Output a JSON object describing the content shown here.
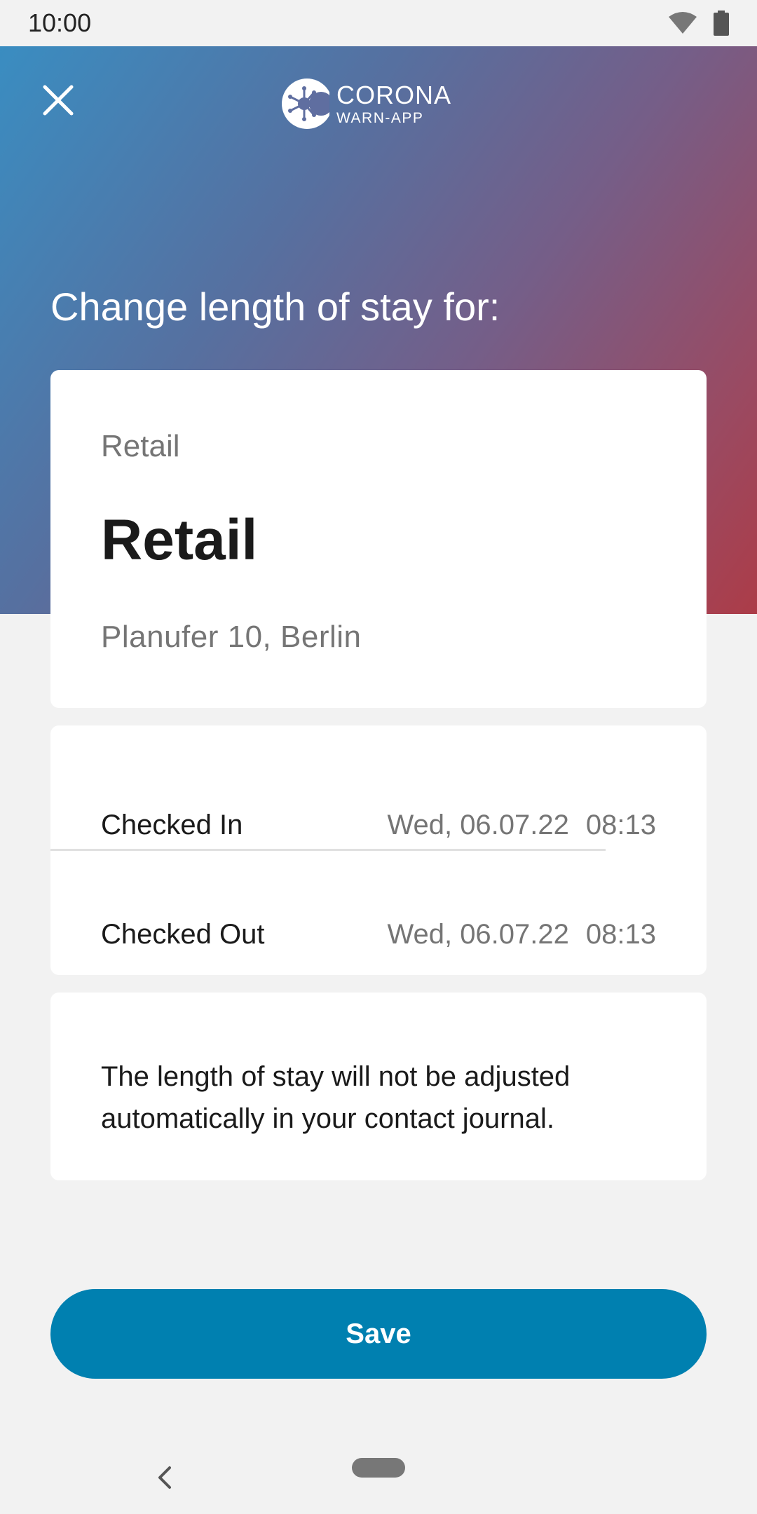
{
  "status_bar": {
    "time": "10:00"
  },
  "header": {
    "logo_line1": "CORONA",
    "logo_line2": "WARN-APP",
    "title": "Change length of stay for:"
  },
  "venue": {
    "type": "Retail",
    "name": "Retail",
    "address": "Planufer 10, Berlin"
  },
  "times": {
    "checked_in_label": "Checked In",
    "checked_in_date": "Wed, 06.07.22",
    "checked_in_time": "08:13",
    "checked_out_label": "Checked Out",
    "checked_out_date": "Wed, 06.07.22",
    "checked_out_time": "08:13"
  },
  "info": {
    "text": "The length of stay will not be adjusted automatically in your contact journal."
  },
  "actions": {
    "save_label": "Save"
  },
  "colors": {
    "primary": "#0080b0",
    "gradient_start": "#3a8dc1",
    "gradient_end": "#ac3c48"
  }
}
